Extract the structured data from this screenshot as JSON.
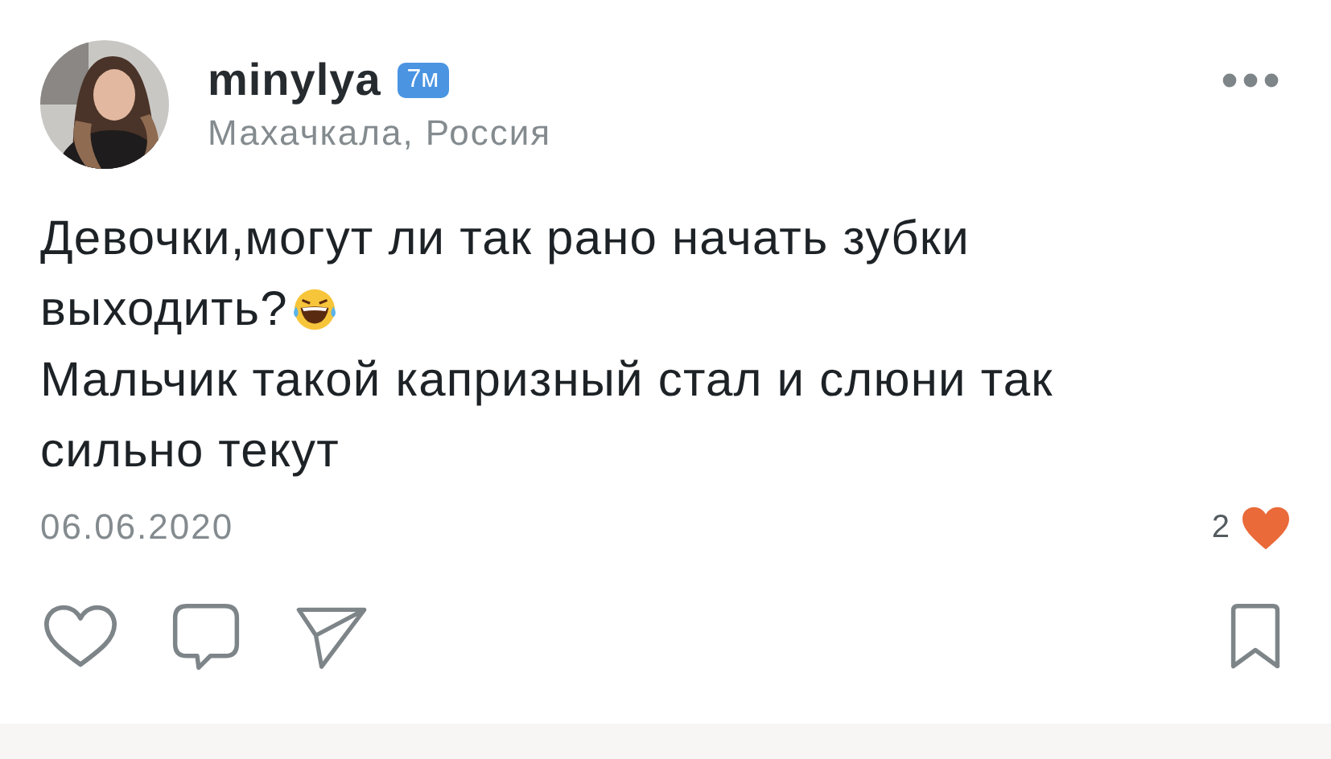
{
  "post": {
    "author": "minylya",
    "badge": "7м",
    "location": "Махачкала, Россия",
    "paragraphs": [
      "Девочки,могут ли так рано начать зубки выходить?",
      "Мальчик такой капризный стал и слюни так сильно текут"
    ],
    "date": "06.06.2020",
    "likes_count": "2",
    "liked": false,
    "saved": false
  }
}
